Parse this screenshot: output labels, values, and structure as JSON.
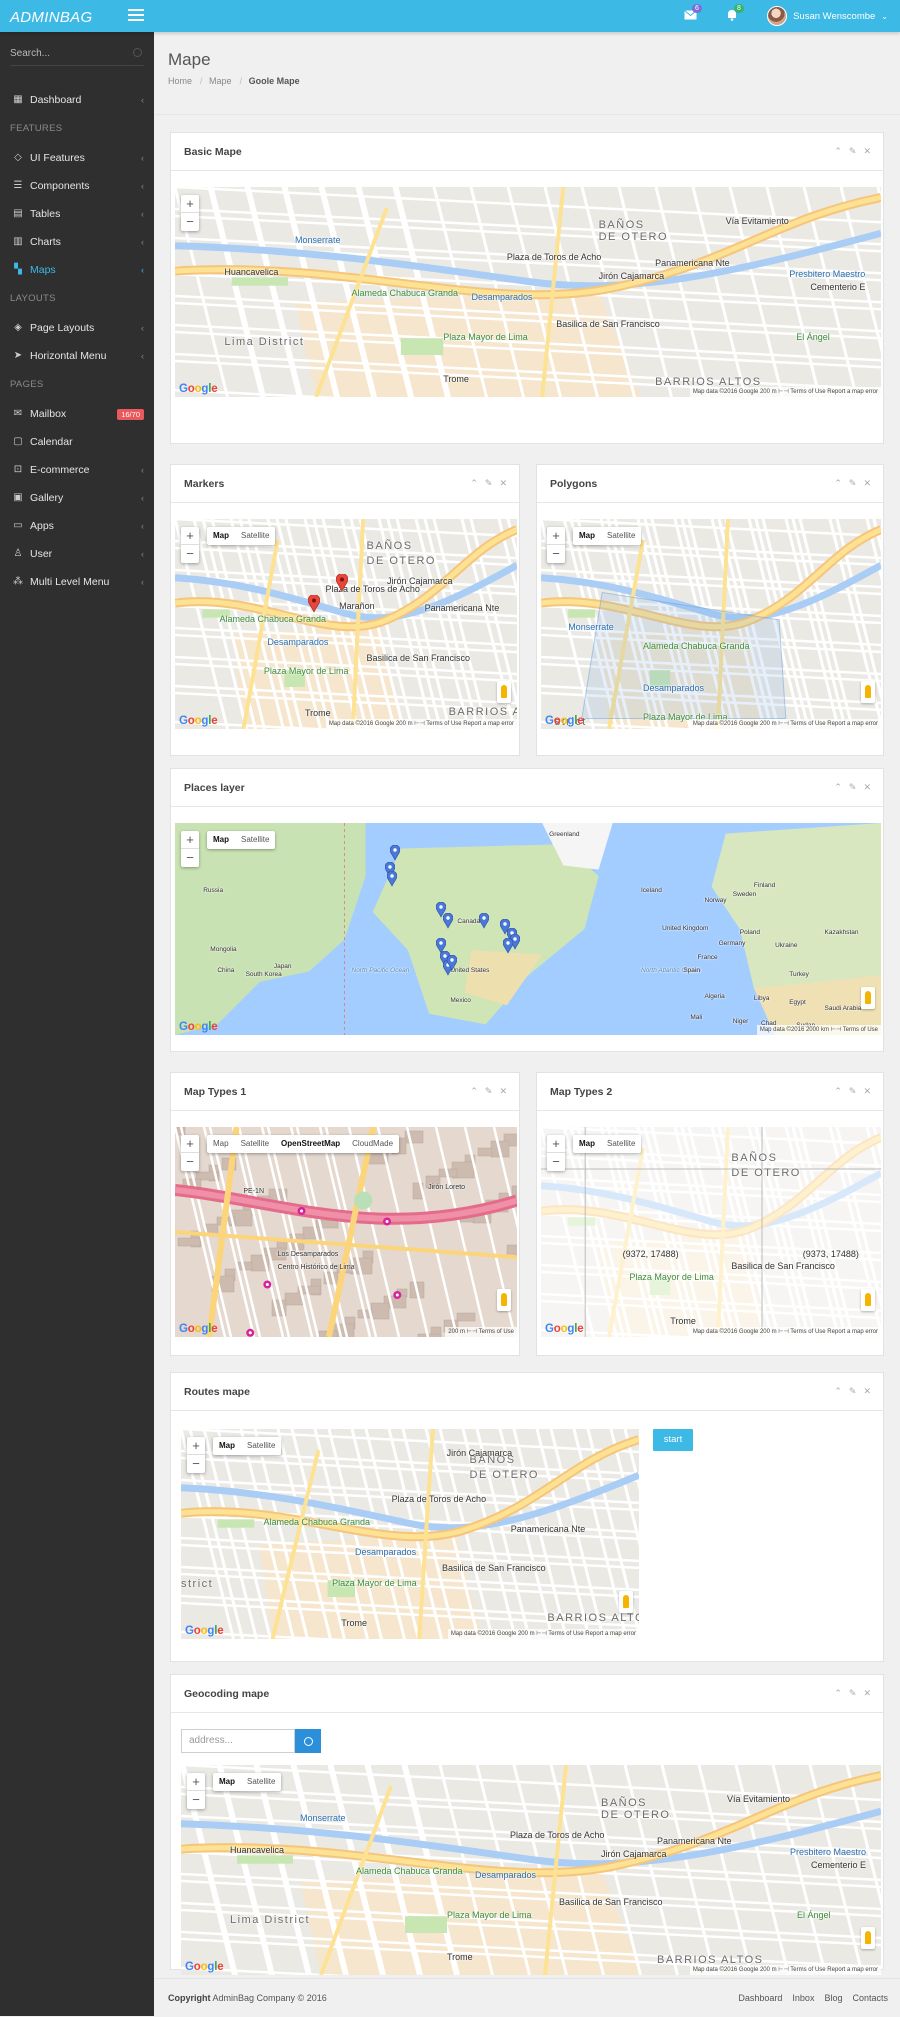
{
  "app": {
    "logo": "ADMINBAG"
  },
  "topbar": {
    "mail_count": "6",
    "notif_count": "8",
    "user_name": "Susan Wenscombe"
  },
  "sidebar": {
    "search_placeholder": "Search...",
    "items": [
      {
        "type": "item",
        "label": "Dashboard",
        "icon": "dashboard-icon",
        "chev": true
      },
      {
        "type": "head",
        "label": "FEATURES"
      },
      {
        "type": "item",
        "label": "UI Features",
        "icon": "diamond-icon",
        "chev": true
      },
      {
        "type": "item",
        "label": "Components",
        "icon": "list-icon",
        "chev": true
      },
      {
        "type": "item",
        "label": "Tables",
        "icon": "table-icon",
        "chev": true
      },
      {
        "type": "item",
        "label": "Charts",
        "icon": "chart-icon",
        "chev": true
      },
      {
        "type": "item",
        "label": "Maps",
        "icon": "map-icon",
        "chev": true,
        "active": true
      },
      {
        "type": "head",
        "label": "LAYOUTS"
      },
      {
        "type": "item",
        "label": "Page Layouts",
        "icon": "layers-icon",
        "chev": true
      },
      {
        "type": "item",
        "label": "Horizontal Menu",
        "icon": "send-icon",
        "chev": true
      },
      {
        "type": "head",
        "label": "PAGES"
      },
      {
        "type": "item",
        "label": "Mailbox",
        "icon": "mail-icon",
        "badge": "16/70"
      },
      {
        "type": "item",
        "label": "Calendar",
        "icon": "calendar-icon"
      },
      {
        "type": "item",
        "label": "E-commerce",
        "icon": "cart-icon",
        "chev": true
      },
      {
        "type": "item",
        "label": "Gallery",
        "icon": "image-icon",
        "chev": true
      },
      {
        "type": "item",
        "label": "Apps",
        "icon": "monitor-icon",
        "chev": true
      },
      {
        "type": "item",
        "label": "User",
        "icon": "user-icon",
        "chev": true
      },
      {
        "type": "item",
        "label": "Multi Level Menu",
        "icon": "sitemap-icon",
        "chev": true
      }
    ]
  },
  "page": {
    "title": "Mape",
    "breadcrumb": [
      "Home",
      "Mape",
      "Goole Mape"
    ]
  },
  "panels": {
    "basic": "Basic Mape",
    "markers": "Markers",
    "polygons": "Polygons",
    "places": "Places layer",
    "types1": "Map Types 1",
    "types2": "Map Types 2",
    "routes": "Routes mape",
    "geocoding": "Geocoding mape"
  },
  "map_ui": {
    "map": "Map",
    "satellite": "Satellite",
    "osm": "OpenStreetMap",
    "cloudmade": "CloudMade",
    "zoom_in": "+",
    "zoom_out": "−",
    "google": [
      "G",
      "o",
      "o",
      "g",
      "l",
      "e"
    ],
    "attr_city": "Map data ©2016 Google    200 m ⊢⊣    Terms of Use    Report a map error",
    "attr_world": "Map data ©2016    2000 km ⊢⊣    Terms of Use",
    "attr_osm": "200 m ⊢⊣    Terms of Use"
  },
  "city_labels": {
    "banos": "BAÑOS",
    "otero": "DE OTERO",
    "plaza_toros": "Plaza de Toros de Acho",
    "jiron_cajamarca": "Jirón Cajamarca",
    "panamericana": "Panamericana Nte",
    "basilica": "Basilica de San Francisco",
    "plaza_mayor": "Plaza Mayor de Lima",
    "alameda": "Alameda Chabuca Granda",
    "lima_district": "Lima District",
    "barrios_altos": "BARRIOS ALTOS",
    "trome": "Trome",
    "desamparados": "Desamparados",
    "monserrate": "Monserrate",
    "huancavelica": "Huancavelica",
    "presbitero": "Presbitero Maestro",
    "cementerio": "Cementerio E",
    "el_angel": "El Ángel",
    "via_evitamiento": "Vía Evitamiento",
    "maranon": "Marañon",
    "istrict": "strict"
  },
  "world_labels": {
    "greenland": "Greenland",
    "canada": "Canada",
    "us": "United States",
    "mexico": "Mexico",
    "russia": "Russia",
    "china": "China",
    "mongolia": "Mongolia",
    "japan": "Japan",
    "south_korea": "South Korea",
    "npo": "North Pacific Ocean",
    "nao": "North Atlantic Ocean",
    "iceland": "Iceland",
    "ukraine": "Ukraine",
    "france": "France",
    "spain": "Spain",
    "germany": "Germany",
    "kazakhstan": "Kazakhstan",
    "turkey": "Turkey",
    "algeria": "Algeria",
    "libya": "Libya",
    "egypt": "Egypt",
    "mali": "Mali",
    "niger": "Niger",
    "chad": "Chad",
    "sudan": "Sudan",
    "saudi": "Saudi Arabia",
    "uk": "United Kingdom",
    "norway": "Norway",
    "sweden": "Sweden",
    "finland": "Finland",
    "poland": "Poland"
  },
  "osm_labels": {
    "pe1n": "PE-1N",
    "los_desamparados": "Los Desamparados",
    "centro": "Centro Histórico de Lima",
    "loreto": "Loreto",
    "jiron_loreto": "Jirón Loreto"
  },
  "types2_labels": {
    "coord1": "(9372, 17488)",
    "coord2": "(9373, 17488)"
  },
  "routes": {
    "start": "start"
  },
  "geocoding": {
    "placeholder": "address..."
  },
  "footer": {
    "copyright": "Copyright",
    "company": "AdminBag Company © 2016",
    "links": [
      "Dashboard",
      "Inbox",
      "Blog",
      "Contacts"
    ]
  },
  "colors": {
    "accent": "#3db9e6",
    "badge_red": "#e9595b",
    "sidebar": "#2f2f2f"
  }
}
